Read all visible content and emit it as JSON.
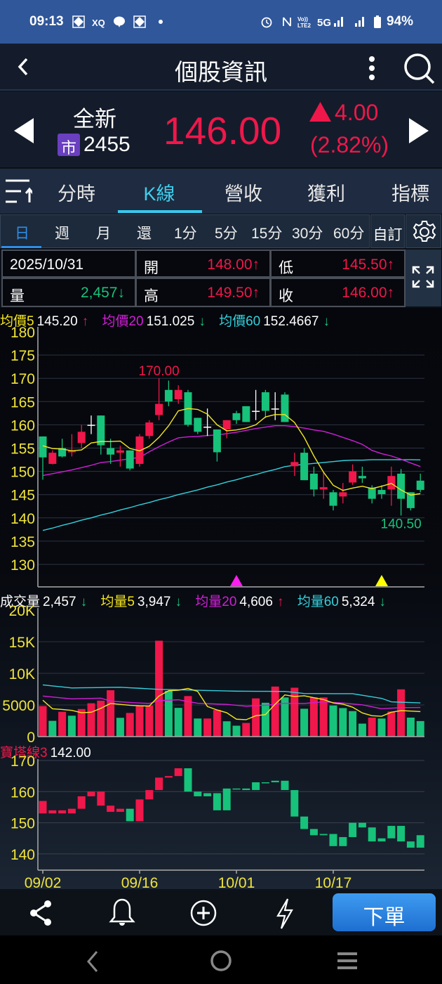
{
  "status_bar": {
    "time": "09:13",
    "xq": "XQ",
    "network": "5G",
    "battery": "94%"
  },
  "header": {
    "title": "個股資訊"
  },
  "quote": {
    "name": "全新",
    "market_badge": "市",
    "code": "2455",
    "price": "146.00",
    "change": "4.00",
    "change_pct": "(2.82%)",
    "colors": {
      "up": "#f0174a",
      "down": "#17c27a"
    }
  },
  "tabs": [
    {
      "label": "分時"
    },
    {
      "label": "K線",
      "active": true
    },
    {
      "label": "營收"
    },
    {
      "label": "獲利"
    },
    {
      "label": "指標"
    }
  ],
  "periods": [
    {
      "label": "日",
      "active": true
    },
    {
      "label": "週"
    },
    {
      "label": "月"
    },
    {
      "label": "還"
    },
    {
      "label": "1分"
    },
    {
      "label": "5分"
    },
    {
      "label": "15分"
    },
    {
      "label": "30分"
    },
    {
      "label": "60分"
    }
  ],
  "custom_label": "自訂",
  "info": {
    "date": "2025/10/31",
    "open_label": "開",
    "open": "148.00↑",
    "low_label": "低",
    "low": "145.50↑",
    "volume_label": "量",
    "volume": "2,457↓",
    "high_label": "高",
    "high": "149.50↑",
    "close_label": "收",
    "close": "146.00↑"
  },
  "ma_legend": {
    "ma5_label": "均價5",
    "ma5": "145.20",
    "ma5_arrow": "↑",
    "ma20_label": "均價20",
    "ma20": "151.025",
    "ma20_arrow": "↓",
    "ma60_label": "均價60",
    "ma60": "152.4667",
    "ma60_arrow": "↓"
  },
  "vol_legend": {
    "vol_label": "成交量",
    "vol": "2,457",
    "vol_arrow": "↓",
    "v5_label": "均量5",
    "v5": "3,947",
    "v5_arrow": "↓",
    "v20_label": "均量20",
    "v20": "4,606",
    "v20_arrow": "↑",
    "v60_label": "均量60",
    "v60": "5,324",
    "v60_arrow": "↓"
  },
  "tower_legend": {
    "label": "寶塔線3",
    "value": "142.00"
  },
  "bottom_bar": {
    "order_label": "下單"
  },
  "chart_data": [
    {
      "type": "candlestick",
      "title": "K線",
      "ylim": [
        125.3,
        181
      ],
      "y_ticks": [
        "130",
        "135",
        "140",
        "145",
        "150",
        "155",
        "160",
        "165",
        "170",
        "175",
        "180"
      ],
      "colors": {
        "up": "#f0174a",
        "down": "#17c27a",
        "doji": "#ffffff",
        "ma5": "#f5e61c",
        "ma20": "#d21ed8",
        "ma60": "#33d0dc"
      },
      "ohlc": [
        [
          157.5,
          157.5,
          148.2,
          153
        ],
        [
          151.6,
          154.5,
          151.5,
          154
        ],
        [
          155,
          157,
          153,
          153.2
        ],
        [
          154.1,
          158,
          153.2,
          154.5
        ],
        [
          156.1,
          160,
          155,
          158.5
        ],
        [
          160,
          162,
          158,
          160
        ],
        [
          162,
          162,
          153.6,
          155.6
        ],
        [
          155,
          157,
          151.6,
          153.6
        ],
        [
          154,
          155.5,
          151,
          154.5
        ],
        [
          154.5,
          154.5,
          150.2,
          150.6
        ],
        [
          151.6,
          158,
          151,
          157.5
        ],
        [
          157.6,
          161,
          157,
          160.5
        ],
        [
          162.1,
          170,
          161,
          164.5
        ],
        [
          167.5,
          169.5,
          164,
          165
        ],
        [
          165.5,
          168.5,
          164.5,
          167.5
        ],
        [
          167,
          167.5,
          159.6,
          160
        ],
        [
          161.5,
          161.5,
          158,
          158.5
        ],
        [
          159.6,
          163.5,
          157.6,
          159.6
        ],
        [
          159,
          159,
          152.1,
          154.1
        ],
        [
          159,
          161,
          157.1,
          161
        ],
        [
          162.5,
          163,
          160.2,
          161
        ],
        [
          164,
          164,
          160.6,
          160.6
        ],
        [
          163,
          167.5,
          161,
          163
        ],
        [
          167,
          167.5,
          161.5,
          163
        ],
        [
          163.5,
          167,
          161,
          163.5
        ],
        [
          166.5,
          167,
          160.6,
          160.6
        ],
        [
          151.1,
          154,
          149,
          152
        ],
        [
          154,
          155,
          148.1,
          148.1
        ],
        [
          149.5,
          151,
          144.6,
          146.1
        ],
        [
          146.1,
          150,
          144.1,
          146.6
        ],
        [
          145.5,
          146,
          141.6,
          142.6
        ],
        [
          144.6,
          147.5,
          143.1,
          145.5
        ],
        [
          147.6,
          151.5,
          147.1,
          150
        ],
        [
          149,
          151,
          147.5,
          148.5
        ],
        [
          146.5,
          147,
          143.1,
          144.1
        ],
        [
          146,
          147,
          144.1,
          145.1
        ],
        [
          146.1,
          151,
          142.6,
          149
        ],
        [
          149.5,
          150.5,
          140.5,
          144.1
        ],
        [
          145.5,
          145.5,
          141.6,
          142.1
        ],
        [
          148,
          149.5,
          145.5,
          146
        ]
      ],
      "ma5": [
        155.5,
        154.9,
        154.8,
        154.4,
        154.6,
        156.1,
        156.4,
        156.4,
        156.5,
        154.9,
        154.4,
        155.4,
        157.3,
        159.8,
        163,
        163.5,
        163.3,
        162.3,
        160,
        158.7,
        158.9,
        159.3,
        160,
        161.7,
        162.2,
        162.2,
        160.5,
        157.3,
        153.3,
        149.8,
        147,
        145.9,
        146.4,
        146.8,
        146.3,
        146.8,
        147.4,
        146,
        144.9,
        145.2
      ],
      "ma20": [
        149.1,
        149.5,
        149.9,
        150.3,
        150.8,
        151.3,
        151.9,
        152.1,
        152.4,
        152.7,
        153,
        154.2,
        155.3,
        156.3,
        157.2,
        157.4,
        157.5,
        157.7,
        157.8,
        158.1,
        158.4,
        158.8,
        159.2,
        159.5,
        159.8,
        159.8,
        159.6,
        159.3,
        158.9,
        158.6,
        158,
        157.3,
        156.6,
        155.8,
        154.5,
        153.8,
        153.3,
        152.6,
        151.8,
        151.025
      ],
      "ma60": [
        137.3,
        137.8,
        138.4,
        138.9,
        139.5,
        140,
        140.6,
        141.1,
        141.7,
        142.2,
        142.8,
        143.3,
        143.9,
        144.4,
        145,
        145.5,
        146,
        146.6,
        147.1,
        147.7,
        148.2,
        148.8,
        149.3,
        149.9,
        150.4,
        151,
        151.3,
        151.5,
        151.7,
        151.9,
        152.1,
        152.3,
        152.4,
        152.4,
        152.5,
        152.5,
        152.5,
        152.5,
        152.5,
        152.4667
      ],
      "annotations": [
        {
          "label": "170.00",
          "index": 12,
          "value": 170,
          "color": "#f0174a"
        },
        {
          "label": "140.50",
          "index": 37,
          "value": 140.5,
          "color": "#17c27a"
        }
      ],
      "signals": [
        {
          "index": 20,
          "color": "#ff1ef0"
        },
        {
          "index": 35,
          "color": "#ffff00"
        }
      ]
    },
    {
      "type": "bar",
      "title": "成交量",
      "ylim": [
        0,
        20000
      ],
      "y_ticks": [
        {
          "label": "0",
          "value": 0
        },
        {
          "label": "5000",
          "value": 5000
        },
        {
          "label": "10K",
          "value": 10000
        },
        {
          "label": "15K",
          "value": 15000
        },
        {
          "label": "20K",
          "value": 20000
        }
      ],
      "values": [
        4830,
        2490,
        3920,
        3300,
        4360,
        5270,
        5680,
        7330,
        2970,
        3740,
        4910,
        4910,
        15160,
        7220,
        4540,
        6410,
        2860,
        2860,
        4210,
        2420,
        1720,
        2160,
        6040,
        5350,
        7910,
        6190,
        7730,
        4400,
        6190,
        6190,
        4910,
        4510,
        4030,
        2050,
        3000,
        2860,
        3960,
        7470,
        3000,
        2457
      ],
      "up": [
        1,
        0,
        1,
        0,
        1,
        1,
        1,
        1,
        0,
        1,
        1,
        1,
        1,
        0,
        0,
        1,
        0,
        1,
        1,
        0,
        0,
        1,
        1,
        0,
        1,
        0,
        1,
        0,
        1,
        1,
        0,
        0,
        0,
        0,
        1,
        0,
        1,
        1,
        0,
        0
      ],
      "ma5": [
        5750,
        4400,
        4290,
        4140,
        3770,
        3850,
        4470,
        5240,
        5090,
        4950,
        4870,
        4830,
        6410,
        7250,
        7330,
        7620,
        7140,
        4760,
        4210,
        3770,
        2750,
        2670,
        3300,
        3480,
        5130,
        6590,
        6340,
        6450,
        6150,
        5860,
        5310,
        5130,
        4650,
        3740,
        3300,
        3220,
        3850,
        4100,
        4030,
        3947
      ],
      "ma20": [
        6410,
        6260,
        6110,
        5970,
        6010,
        6040,
        6080,
        5600,
        5500,
        5400,
        5310,
        5240,
        5680,
        5750,
        5820,
        5550,
        5270,
        5210,
        5150,
        5090,
        4950,
        4800,
        4880,
        4950,
        5110,
        5270,
        5260,
        5240,
        5370,
        5490,
        5400,
        5310,
        5160,
        5020,
        4710,
        4400,
        4490,
        4580,
        4590,
        4606
      ],
      "ma60": [
        8170,
        8010,
        7850,
        7690,
        7710,
        7730,
        7760,
        7780,
        7800,
        7720,
        7640,
        7550,
        7470,
        7440,
        7400,
        7370,
        7330,
        7290,
        7260,
        7220,
        7180,
        7170,
        7160,
        7160,
        7150,
        7140,
        6980,
        6810,
        6800,
        6800,
        6790,
        6790,
        6780,
        6530,
        6290,
        6040,
        5490,
        5430,
        5380,
        5324
      ]
    },
    {
      "type": "tower",
      "title": "寶塔線3",
      "ylim": [
        135,
        170.5
      ],
      "y_ticks": [
        "140",
        "150",
        "160",
        "170"
      ],
      "bars": [
        [
          157,
          153,
          1
        ],
        [
          154,
          153,
          1
        ],
        [
          154,
          153,
          1
        ],
        [
          154.5,
          153,
          1
        ],
        [
          158.5,
          154.5,
          1
        ],
        [
          160,
          158.5,
          1
        ],
        [
          160,
          155.5,
          1
        ],
        [
          155.5,
          153.5,
          1
        ],
        [
          154.5,
          153.5,
          1
        ],
        [
          154.5,
          150.5,
          0
        ],
        [
          157.5,
          150.5,
          1
        ],
        [
          160.5,
          157.5,
          1
        ],
        [
          164.5,
          160.5,
          1
        ],
        [
          165,
          164.5,
          1
        ],
        [
          167.5,
          165,
          1
        ],
        [
          167.5,
          160,
          0
        ],
        [
          160,
          158.5,
          0
        ],
        [
          159.5,
          158.5,
          0
        ],
        [
          159.5,
          154,
          0
        ],
        [
          161,
          154,
          0
        ],
        [
          161,
          160.9,
          0
        ],
        [
          161,
          160.5,
          0
        ],
        [
          163,
          160.5,
          0
        ],
        [
          163,
          162.9,
          0
        ],
        [
          163.5,
          163,
          0
        ],
        [
          163.5,
          160.5,
          0
        ],
        [
          160.5,
          152,
          0
        ],
        [
          152,
          148,
          0
        ],
        [
          148,
          146,
          0
        ],
        [
          146.4,
          146,
          0
        ],
        [
          146.4,
          142.5,
          0
        ],
        [
          145.4,
          142.5,
          0
        ],
        [
          150,
          145.4,
          0
        ],
        [
          150,
          148.5,
          0
        ],
        [
          148.5,
          144,
          0
        ],
        [
          145,
          144,
          0
        ],
        [
          149,
          145,
          0
        ],
        [
          149,
          144,
          0
        ],
        [
          144,
          142,
          0
        ],
        [
          146,
          142,
          0
        ]
      ],
      "x_ticks": [
        {
          "label": "09/02",
          "index": 0
        },
        {
          "label": "09/16",
          "index": 10
        },
        {
          "label": "10/01",
          "index": 20
        },
        {
          "label": "10/17",
          "index": 30
        }
      ]
    }
  ]
}
